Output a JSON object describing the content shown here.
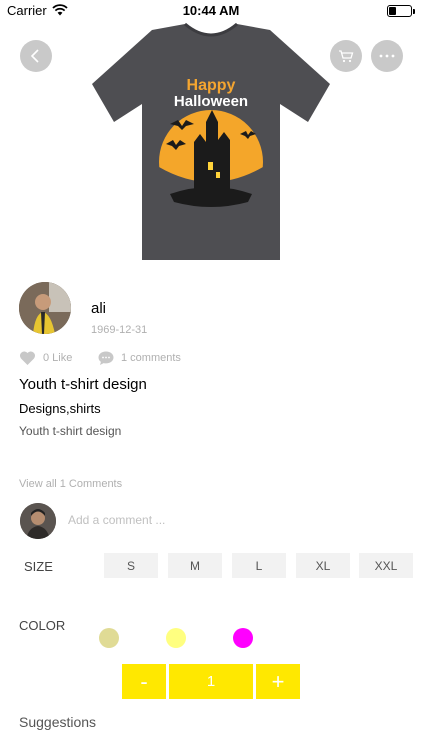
{
  "status_bar": {
    "carrier": "Carrier",
    "time": "10:44 AM"
  },
  "hero": {
    "back_icon": "chevron-left-icon",
    "cart_icon": "cart-icon",
    "more_icon": "ellipsis-icon",
    "product_image": {
      "line1": "Happy",
      "line2": "Halloween"
    }
  },
  "author": {
    "name": "ali",
    "date": "1969-12-31"
  },
  "stats": {
    "likes": "0 Like",
    "comments": "1 comments"
  },
  "post": {
    "title": "Youth t-shirt design",
    "tags": "Designs,shirts",
    "description": "Youth t-shirt design"
  },
  "comments": {
    "view_all": "View all 1 Comments",
    "placeholder": "Add a comment ..."
  },
  "size": {
    "label": "SIZE",
    "options": [
      "S",
      "M",
      "L",
      "XL",
      "XXL"
    ]
  },
  "color": {
    "label": "COLOR",
    "swatches": [
      "#e0db95",
      "#ffff80",
      "#ff00ff"
    ]
  },
  "quantity": {
    "minus": "-",
    "value": "1",
    "plus": "+",
    "accent": "#ffe800"
  },
  "suggestions": {
    "label": "Suggestions"
  }
}
